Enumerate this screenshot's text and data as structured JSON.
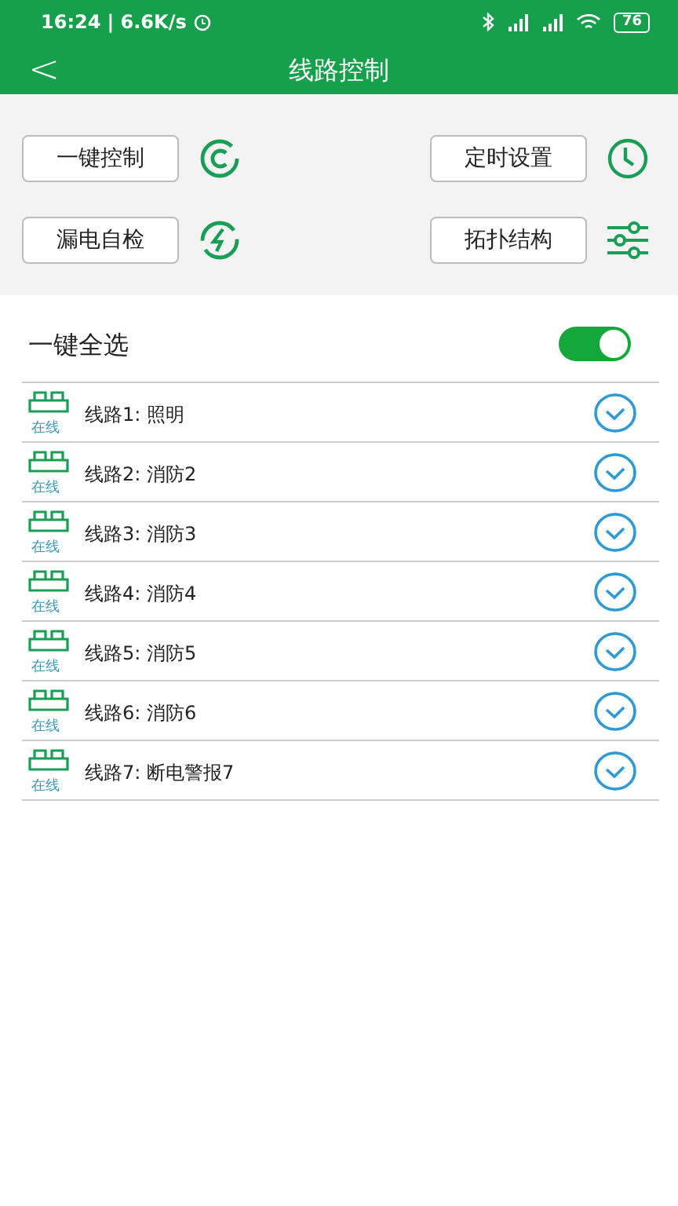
{
  "status_bar": {
    "time": "16:24",
    "speed": "| 6.6K/s",
    "battery": "76"
  },
  "header": {
    "back": "<",
    "title": "线路控制"
  },
  "actions": [
    {
      "label": "一键控制"
    },
    {
      "label": "定时设置"
    },
    {
      "label": "漏电自检"
    },
    {
      "label": "拓扑结构"
    }
  ],
  "select_all": {
    "label": "一键全选",
    "on": true
  },
  "lines": [
    {
      "name": "线路1: 照明",
      "status": "在线",
      "checked": true
    },
    {
      "name": "线路2: 消防2",
      "status": "在线",
      "checked": true
    },
    {
      "name": "线路3: 消防3",
      "status": "在线",
      "checked": true
    },
    {
      "name": "线路4: 消防4",
      "status": "在线",
      "checked": true
    },
    {
      "name": "线路5: 消防5",
      "status": "在线",
      "checked": true
    },
    {
      "name": "线路6: 消防6",
      "status": "在线",
      "checked": true
    },
    {
      "name": "线路7: 断电警报7",
      "status": "在线",
      "checked": true
    }
  ]
}
